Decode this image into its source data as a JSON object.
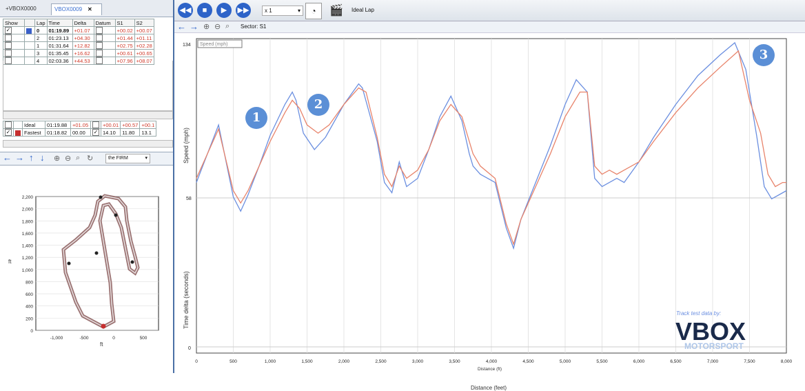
{
  "tabs": {
    "inactive": "+VBOX0000",
    "active": "VBOX0009",
    "close": "✕"
  },
  "lap_table": {
    "headers": [
      "Show",
      "Lap",
      "Time",
      "Delta",
      "Datum",
      "S1",
      "S2"
    ],
    "rows": [
      {
        "show": "✓",
        "lap": "0",
        "time": "01:19.89",
        "delta": "+01.07",
        "s1": "+00.02",
        "s2": "+00.07",
        "color": "#3a5fc8"
      },
      {
        "show": "",
        "lap": "2",
        "time": "01:23.13",
        "delta": "+04.30",
        "s1": "+01.44",
        "s2": "+01.11",
        "color": ""
      },
      {
        "show": "",
        "lap": "1",
        "time": "01:31.64",
        "delta": "+12.82",
        "s1": "+02.75",
        "s2": "+02.28",
        "color": ""
      },
      {
        "show": "",
        "lap": "3",
        "time": "01:35.45",
        "delta": "+16.62",
        "s1": "+00.61",
        "s2": "+00.65",
        "color": ""
      },
      {
        "show": "",
        "lap": "4",
        "time": "02:03.36",
        "delta": "+44.53",
        "s1": "+07.96",
        "s2": "+08.07",
        "color": ""
      }
    ]
  },
  "summary": {
    "ideal": {
      "label": "Ideal",
      "time": "01:19.88",
      "delta": "+01.05",
      "s1": "+00.01",
      "s2": "+00.57",
      "s3": "+00.1"
    },
    "fastest": {
      "label": "Fastest",
      "time": "01:18.82",
      "delta": "00.00",
      "s1": "14.10",
      "s2": "11.80",
      "s3": "13.1"
    }
  },
  "map": {
    "track_select": "the FIRM",
    "y_axis_label": "ft",
    "x_axis_label": "ft",
    "y_ticks": [
      "2,200",
      "2,000",
      "1,800",
      "1,600",
      "1,400",
      "1,200",
      "1,000",
      "800",
      "600",
      "400",
      "200",
      "0"
    ],
    "x_ticks": [
      "-1,000",
      "-500",
      "0",
      "500"
    ]
  },
  "toolbar": {
    "speed": "x 1",
    "ideal_lap": "Ideal Lap",
    "sector": "Sector: S1"
  },
  "chart": {
    "legend": "Speed (mph)",
    "y_top": "134",
    "y_mid": "58",
    "y_bottom": "0",
    "ylabel_speed": "Speed (mph)",
    "ylabel_delta": "Time delta (seconds)",
    "xlabel_small": "Distance (ft)",
    "xlabel_big": "Distance (feet)",
    "x_ticks": [
      "0",
      "500",
      "1,000",
      "1,500",
      "2,000",
      "2,500",
      "3,000",
      "3,500",
      "4,000",
      "4,500",
      "5,000",
      "5,500",
      "6,000",
      "6,500",
      "7,000",
      "7,500",
      "8,000"
    ],
    "badges": [
      "1",
      "2",
      "3"
    ],
    "credit": "Track test data by:",
    "logo_main": "VBOX",
    "logo_sub": "MOTORSPORT"
  },
  "chart_data": {
    "type": "line",
    "x_range": [
      0,
      8000
    ],
    "y_range_speed": [
      0,
      134
    ],
    "series": [
      {
        "color": "#6b8fe0",
        "x": [
          0,
          300,
          500,
          600,
          700,
          850,
          1000,
          1200,
          1300,
          1350,
          1450,
          1600,
          1750,
          2000,
          2200,
          2250,
          2450,
          2550,
          2650,
          2750,
          2850,
          3000,
          3150,
          3300,
          3450,
          3600,
          3700,
          3750,
          3850,
          4050,
          4200,
          4300,
          4400,
          4600,
          4800,
          5000,
          5150,
          5300,
          5400,
          5500,
          5600,
          5700,
          5800,
          6000,
          6200,
          6500,
          6800,
          7100,
          7300,
          7450,
          7600,
          7700,
          7800,
          7900,
          8000
        ],
        "y": [
          80,
          108,
          73,
          66,
          74,
          88,
          103,
          118,
          124,
          120,
          104,
          96,
          102,
          118,
          128,
          126,
          100,
          80,
          75,
          90,
          78,
          82,
          96,
          112,
          122,
          110,
          94,
          88,
          84,
          80,
          58,
          48,
          62,
          80,
          98,
          118,
          130,
          124,
          82,
          78,
          80,
          82,
          80,
          90,
          102,
          118,
          132,
          142,
          148,
          135,
          102,
          78,
          72,
          74,
          76
        ]
      },
      {
        "color": "#e8836a",
        "x": [
          0,
          300,
          500,
          600,
          700,
          850,
          1000,
          1200,
          1300,
          1400,
          1500,
          1650,
          1800,
          2000,
          2200,
          2300,
          2450,
          2550,
          2650,
          2750,
          2850,
          3000,
          3150,
          3300,
          3450,
          3600,
          3700,
          3750,
          3850,
          4050,
          4200,
          4300,
          4400,
          4600,
          4800,
          5000,
          5200,
          5300,
          5400,
          5500,
          5600,
          5700,
          5800,
          6000,
          6200,
          6500,
          6800,
          7100,
          7350,
          7500,
          7650,
          7750,
          7850,
          7950,
          8000
        ],
        "y": [
          82,
          106,
          76,
          70,
          76,
          88,
          100,
          114,
          120,
          116,
          108,
          104,
          108,
          118,
          126,
          124,
          102,
          84,
          78,
          88,
          82,
          86,
          96,
          110,
          118,
          112,
          100,
          94,
          88,
          82,
          60,
          50,
          62,
          78,
          94,
          112,
          124,
          124,
          88,
          84,
          86,
          84,
          86,
          90,
          100,
          114,
          126,
          136,
          144,
          120,
          104,
          84,
          78,
          80,
          80
        ]
      }
    ]
  }
}
